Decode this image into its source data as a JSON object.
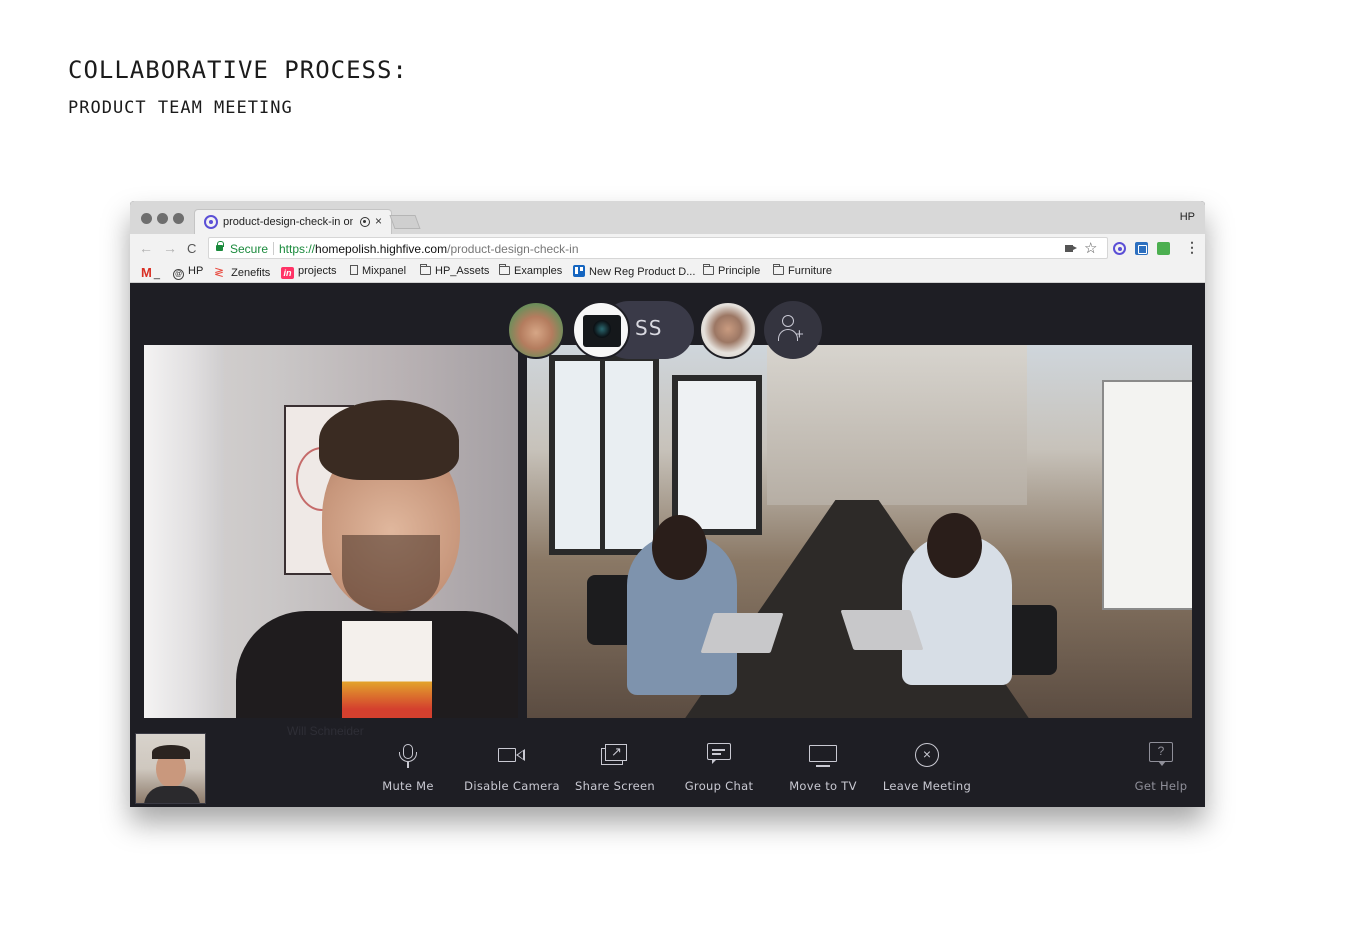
{
  "slide": {
    "title": "COLLABORATIVE PROCESS:",
    "subtitle": "PRODUCT TEAM MEETING"
  },
  "browser": {
    "tab_title": "product-design-check-in on HighFive",
    "tab_close": "×",
    "profile_label": "HP",
    "nav_back": "←",
    "nav_forward": "→",
    "nav_reload": "C",
    "secure_label": "Secure",
    "url_scheme": "https://",
    "url_host": "homepolish.highfive.com",
    "url_path": "/product-design-check-in",
    "star": "☆",
    "menu": "⋮",
    "bookmarks": [
      {
        "label": "_",
        "icon": "gmail-icon",
        "glyph": "M"
      },
      {
        "label": "HP",
        "icon": "hp-icon",
        "glyph": "@"
      },
      {
        "label": "Zenefits",
        "icon": "zenefits-icon",
        "glyph": "≷"
      },
      {
        "label": "projects",
        "icon": "invision-icon",
        "glyph": "in"
      },
      {
        "label": "Mixpanel",
        "icon": "page-icon",
        "glyph": ""
      },
      {
        "label": "HP_Assets",
        "icon": "folder-icon",
        "glyph": ""
      },
      {
        "label": "Examples",
        "icon": "folder-icon",
        "glyph": ""
      },
      {
        "label": "New Reg Product D...",
        "icon": "trello-icon",
        "glyph": ""
      },
      {
        "label": "Principle",
        "icon": "folder-icon",
        "glyph": ""
      },
      {
        "label": "Furniture",
        "icon": "folder-icon",
        "glyph": ""
      }
    ]
  },
  "meeting": {
    "participants_initials": "SS",
    "add_participant_plus": "+",
    "tile_names": [
      "Will Schneider"
    ],
    "controls": [
      {
        "label": "Mute Me",
        "icon": "microphone-icon"
      },
      {
        "label": "Disable Camera",
        "icon": "camera-icon"
      },
      {
        "label": "Share Screen",
        "icon": "share-screen-icon"
      },
      {
        "label": "Group Chat",
        "icon": "chat-icon"
      },
      {
        "label": "Move to TV",
        "icon": "tv-icon"
      },
      {
        "label": "Leave Meeting",
        "icon": "close-circle-icon",
        "glyph": "×"
      }
    ],
    "help": {
      "label": "Get Help",
      "icon": "help-icon",
      "glyph": "?"
    }
  },
  "colors": {
    "app_background": "#1e1e24",
    "control_text": "#c9c9d2",
    "secure_green": "#1a8a3c",
    "highfive_purple": "#5b4fd6"
  }
}
